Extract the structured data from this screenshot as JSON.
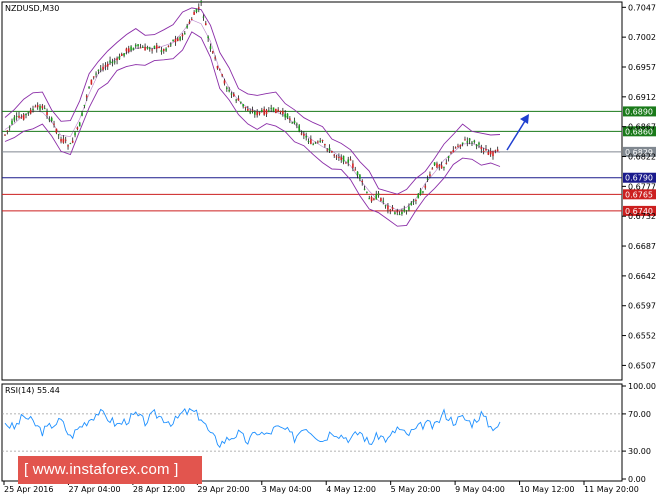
{
  "chart_data": {
    "type": "line",
    "title": "NZDUSD,M30",
    "price_ticks": [
      "0.7047",
      "0.7002",
      "0.6957",
      "0.6912",
      "0.6867",
      "0.6822",
      "0.6777",
      "0.6732",
      "0.6687",
      "0.6642",
      "0.6597",
      "0.6552",
      "0.6507"
    ],
    "ylim": [
      0.6485,
      0.7055
    ],
    "x_labels": [
      "25 Apr 2016",
      "27 Apr 04:00",
      "28 Apr 12:00",
      "29 Apr 20:00",
      "3 May 04:00",
      "4 May 12:00",
      "5 May 20:00",
      "9 May 04:00",
      "10 May 12:00",
      "11 May 20:00"
    ],
    "levels": [
      {
        "label": "0.6890",
        "value": 0.689,
        "color": "#1a7a1a"
      },
      {
        "label": "0.6860",
        "value": 0.686,
        "color": "#1a7a1a"
      },
      {
        "label": "0.6829",
        "value": 0.6829,
        "color": "#808890"
      },
      {
        "label": "0.6790",
        "value": 0.679,
        "color": "#1a1a8c"
      },
      {
        "label": "0.6765",
        "value": 0.6765,
        "color": "#cc1f1f"
      },
      {
        "label": "0.6740",
        "value": 0.674,
        "color": "#cc1f1f"
      }
    ],
    "price_series": [
      0.6855,
      0.6878,
      0.6882,
      0.6893,
      0.6898,
      0.6876,
      0.6848,
      0.6838,
      0.687,
      0.6928,
      0.6952,
      0.6962,
      0.6966,
      0.6982,
      0.6988,
      0.6984,
      0.6988,
      0.6982,
      0.6997,
      0.7002,
      0.703,
      0.7052,
      0.6985,
      0.695,
      0.692,
      0.6906,
      0.6893,
      0.6887,
      0.689,
      0.6892,
      0.6885,
      0.6874,
      0.6855,
      0.684,
      0.6843,
      0.6828,
      0.682,
      0.6814,
      0.679,
      0.6757,
      0.6763,
      0.6746,
      0.6736,
      0.6741,
      0.6759,
      0.6776,
      0.681,
      0.6808,
      0.6832,
      0.6844,
      0.6846,
      0.6836,
      0.6826,
      0.6829
    ],
    "rsi": {
      "label": "RSI(14) 55.44",
      "value": 55.44,
      "ticks": [
        "100.00",
        "70.00",
        "30.00",
        "0.00"
      ],
      "levels": [
        70,
        30
      ],
      "series": [
        60,
        55,
        68,
        61,
        51,
        58,
        63,
        45,
        56,
        64,
        72,
        66,
        58,
        63,
        69,
        61,
        70,
        65,
        60,
        71,
        73,
        66,
        48,
        38,
        44,
        49,
        40,
        51,
        47,
        55,
        53,
        44,
        57,
        50,
        41,
        52,
        47,
        43,
        51,
        38,
        47,
        42,
        55,
        47,
        53,
        60,
        56,
        71,
        62,
        66,
        60,
        70,
        56,
        58
      ]
    },
    "arrow": {
      "from": [
        0.6829,
        0.6829
      ],
      "direction": "up"
    },
    "color": "#1e90ff",
    "grid": false
  },
  "watermark": "[ www.instaforex.com ]"
}
